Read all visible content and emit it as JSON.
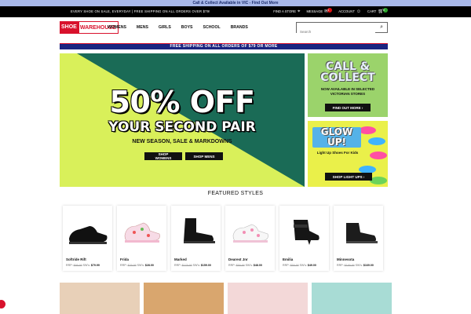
{
  "top_banner": {
    "text": "Call & Collect Available in VIC - Find Out More"
  },
  "utility_bar": {
    "promo": "EVERY SHOE ON SALE, EVERYDAY  |  FREE SHIPPING ON ALL ORDERS OVER $79!",
    "find_store": "FIND A STORE",
    "message": "MESSAGE",
    "message_count": "1",
    "account": "ACCOUNT",
    "cart": "CART",
    "cart_count": "0"
  },
  "nav": {
    "logo_left": "SHOE",
    "logo_right": "WAREHOUSE",
    "items": [
      "WOMENS",
      "MENS",
      "GIRLS",
      "BOYS",
      "SCHOOL",
      "BRANDS"
    ],
    "search_placeholder": "Search"
  },
  "shipping_banner": "FREE SHIPPING ON ALL ORDERS OF $79 OR MORE",
  "hero": {
    "headline": "50% OFF",
    "subheadline": "YOUR SECOND PAIR",
    "tagline": "NEW SEASON, SALE & MARKDOWNS",
    "btn_women": "SHOP WOMENS",
    "btn_men": "SHOP MENS",
    "colors": {
      "green": "#1a6b56",
      "lime": "#d9f05a"
    }
  },
  "side_promo_1": {
    "title_1": "CALL &",
    "title_2": "COLLECT",
    "text_1": "NOW AVAILABLE IN SELECTED",
    "text_2": "VICTORIAN STORES",
    "button": "FIND OUT MORE ›"
  },
  "side_promo_2": {
    "title_1": "GLOW",
    "title_2": "UP!",
    "text": "Light Up Shoes For Kids",
    "button": "SHOP LIGHT UPS ›"
  },
  "featured": {
    "heading": "FEATURED STYLES",
    "products": [
      {
        "name": "Softride Rift",
        "rrp": "RRP",
        "was_label": "",
        "was": "$99.99",
        "sw_label": "SW's",
        "price": "$79.99",
        "icon": "black-sneaker-icon"
      },
      {
        "name": "Frida",
        "rrp": "RRP",
        "was_label": "",
        "was": "$29.99",
        "sw_label": "SW's",
        "price": "$28.00",
        "icon": "floral-sneaker-icon"
      },
      {
        "name": "Marked",
        "rrp": "RRP",
        "was_label": "",
        "was": "$179.99",
        "sw_label": "SW's",
        "price": "$159.00",
        "icon": "chelsea-boot-icon"
      },
      {
        "name": "Dearest Jnr",
        "rrp": "RRP",
        "was_label": "",
        "was": "$59.99",
        "sw_label": "SW's",
        "price": "$48.00",
        "icon": "pink-sneaker-icon"
      },
      {
        "name": "Emilia",
        "rrp": "RRP",
        "was_label": "",
        "was": "$59.99",
        "sw_label": "SW's",
        "price": "$49.00",
        "icon": "peep-toe-boot-icon"
      },
      {
        "name": "Minnesota",
        "rrp": "RRP",
        "was_label": "",
        "was": "$199.99",
        "sw_label": "SW's",
        "price": "$169.00",
        "icon": "ankle-boot-icon"
      }
    ]
  },
  "colors": {
    "brand_red": "#d8112c",
    "navy": "#1b2480",
    "top_banner": "#a9b9ea"
  }
}
